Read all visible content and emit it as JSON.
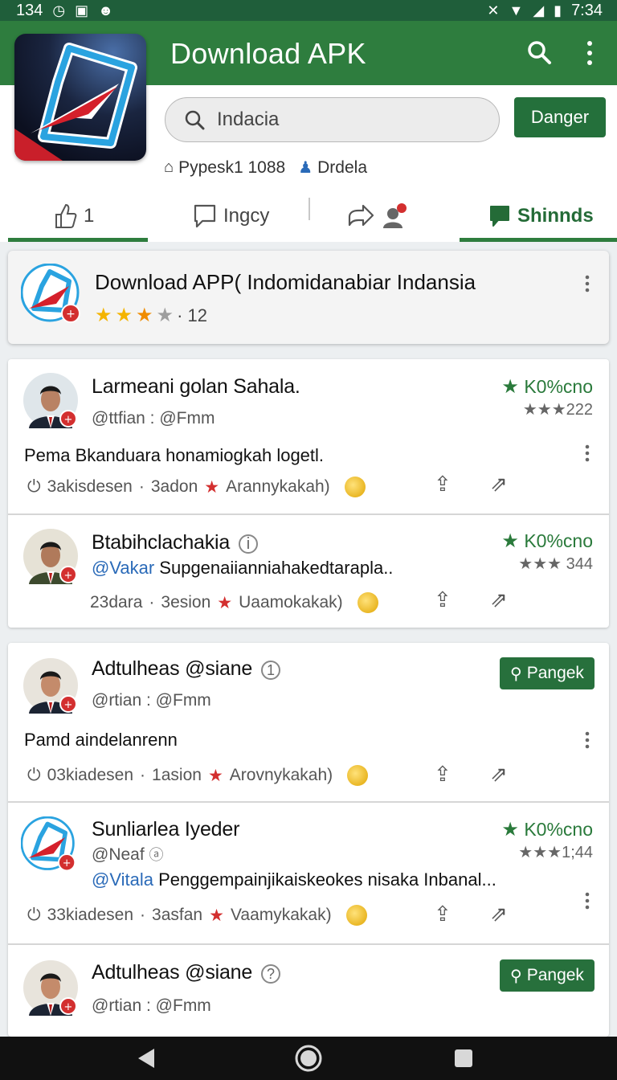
{
  "status_bar": {
    "time_left": "134",
    "time_right": "7:34"
  },
  "header": {
    "title": "Download APK"
  },
  "search": {
    "value": "Indacia",
    "action_label": "Danger"
  },
  "meta": {
    "item1": "Pypesk1 1088",
    "item2": "Drdela"
  },
  "tabs": [
    {
      "label": "1"
    },
    {
      "label": "Ingcy"
    },
    {
      "label": ""
    },
    {
      "label": "Shinnds"
    }
  ],
  "feature": {
    "title": "Download APP( Indomidanabiar Indansia",
    "rating": "· 12"
  },
  "posts": [
    {
      "author": "Larmeani golan Sahala.",
      "handle_prefix": "",
      "handle": "@ttfian : @Fmm",
      "text": "Pema Bkanduara honamiogkah logetl.",
      "score": "K0%cno",
      "score_sub": "★★★222",
      "views": "3akisdesen",
      "time": "3adon",
      "tag": "Arannykakah)"
    },
    {
      "author": "Btabihclachakia",
      "handle_prefix": "@Vakar",
      "handle": "Supgenaiianniahakedtarapla..",
      "text": "",
      "score": "K0%cno",
      "score_sub": "★★★ 344",
      "views": "23dara",
      "time": "3esion",
      "tag": "Uaamokakak)"
    },
    {
      "author": "Adtulheas @siane",
      "handle_prefix": "",
      "handle": "@rtian : @Fmm",
      "text": "Pamd aindelanrenn",
      "button": "Pangek",
      "views": "03kiadesen",
      "time": "1asion",
      "tag": "Arovnykakah)"
    },
    {
      "author": "Sunliarlea Iyeder",
      "handle_prefix": "",
      "handle": "@Neaf",
      "text_prefix": "@Vitala",
      "text": "Penggempainjikaiskeokes nisaka Inbanal...",
      "score": "K0%cno",
      "score_sub": "★★★1;44",
      "views": "33kiadesen",
      "time": "3asfan",
      "tag": "Vaamykakak)"
    },
    {
      "author": "Adtulheas @siane",
      "handle_prefix": "",
      "handle": "@rtian : @Fmm",
      "button": "Pangek"
    }
  ]
}
